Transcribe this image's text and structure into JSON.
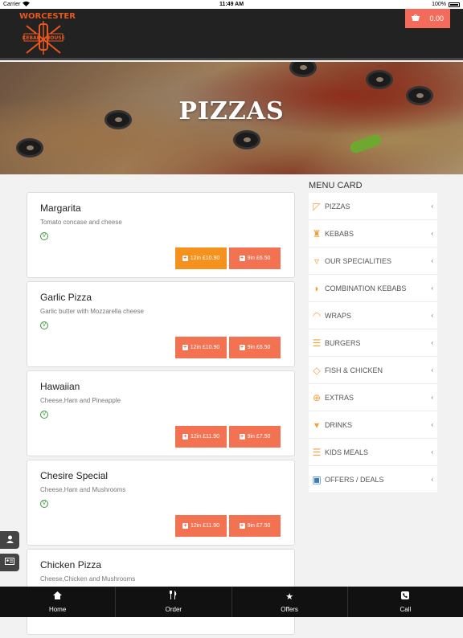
{
  "status": {
    "carrier": "Carrier",
    "time": "11:49 AM",
    "battery": "100%"
  },
  "header": {
    "logo_top": "WORCESTER",
    "logo_left": "KEBAB",
    "logo_right": "HOUSE",
    "cart_total": "0.00"
  },
  "hero": {
    "title": "PIZZAS"
  },
  "items": [
    {
      "name": "Margarita",
      "desc": "Tomato concase and cheese",
      "prices": [
        "12in £10.90",
        "9in £6.50"
      ]
    },
    {
      "name": "Garlic Pizza",
      "desc": "Garlic butter with Mozzarella cheese",
      "prices": [
        "12in £10.90",
        "9in £6.50"
      ]
    },
    {
      "name": "Hawaiian",
      "desc": "Cheese,Ham and Pineapple",
      "prices": [
        "12in £11.90",
        "9in £7.50"
      ]
    },
    {
      "name": "Chesire Special",
      "desc": "Cheese,Ham and Mushrooms",
      "prices": [
        "12in £11.90",
        "9in £7.50"
      ]
    },
    {
      "name": "Chicken Pizza",
      "desc": "Cheese,Chicken and Mushrooms",
      "prices": []
    }
  ],
  "menu": {
    "title": "MENU CARD",
    "items": [
      {
        "label": "PIZZAS",
        "icon": "pizza-icon"
      },
      {
        "label": "KEBABS",
        "icon": "kebab-icon"
      },
      {
        "label": "OUR SPECIALITIES",
        "icon": "cup-icon"
      },
      {
        "label": "COMBINATION KEBABS",
        "icon": "combination-icon"
      },
      {
        "label": "WRAPS",
        "icon": "wrap-icon"
      },
      {
        "label": "BURGERS",
        "icon": "burger-icon"
      },
      {
        "label": "FISH & CHICKEN",
        "icon": "fish-icon"
      },
      {
        "label": "EXTRAS",
        "icon": "plus-circle-icon"
      },
      {
        "label": "DRINKS",
        "icon": "drink-icon"
      },
      {
        "label": "KIDS MEALS",
        "icon": "kids-meal-icon"
      },
      {
        "label": "OFFERS / DEALS",
        "icon": "offers-icon"
      }
    ]
  },
  "tabs": [
    {
      "label": "Home",
      "icon": "home-icon"
    },
    {
      "label": "Order",
      "icon": "cutlery-icon"
    },
    {
      "label": "Offers",
      "icon": "star-icon"
    },
    {
      "label": "Call",
      "icon": "phone-icon"
    }
  ],
  "colors": {
    "accent": "#f37252",
    "active_price": "#f5921e",
    "header_bg": "#222222",
    "cart_bg": "#f26b5b"
  }
}
